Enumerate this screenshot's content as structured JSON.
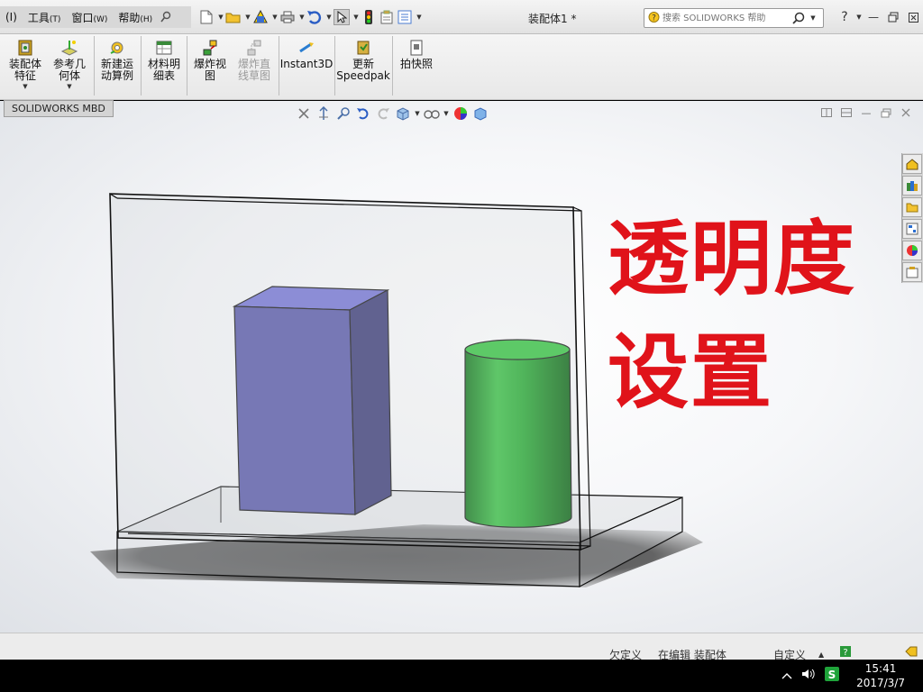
{
  "titlebar": {
    "menus": [
      {
        "label": "(I)",
        "accel": ""
      },
      {
        "label": "工具",
        "accel": "(T)"
      },
      {
        "label": "窗口",
        "accel": "(W)"
      },
      {
        "label": "帮助",
        "accel": "(H)"
      }
    ],
    "doc_title": "装配体1 *",
    "search_placeholder": "搜索 SOLIDWORKS 帮助"
  },
  "ribbon": {
    "buttons": [
      {
        "name": "assembly-features",
        "label": "装配体\n特征",
        "icon": "assembly-features-icon",
        "disabled": false
      },
      {
        "name": "reference-geometry",
        "label": "参考几\n何体",
        "icon": "reference-geometry-icon",
        "disabled": false
      },
      {
        "name": "new-motion-study",
        "label": "新建运\n动算例",
        "icon": "motion-study-icon",
        "disabled": false
      },
      {
        "name": "bill-of-materials",
        "label": "材料明\n细表",
        "icon": "bom-icon",
        "disabled": false
      },
      {
        "name": "exploded-view",
        "label": "爆炸视\n图",
        "icon": "exploded-view-icon",
        "disabled": false
      },
      {
        "name": "explode-line-sketch",
        "label": "爆炸直\n线草图",
        "icon": "explode-line-icon",
        "disabled": true
      },
      {
        "name": "instant3d",
        "label": "Instant3D",
        "icon": "instant3d-icon",
        "disabled": false
      },
      {
        "name": "update-speedpak",
        "label": "更新\nSpeedpak",
        "icon": "speedpak-icon",
        "disabled": false
      },
      {
        "name": "take-snapshot",
        "label": "拍快照",
        "icon": "snapshot-icon",
        "disabled": false
      }
    ]
  },
  "tabs": {
    "mbd": "SOLIDWORKS MBD"
  },
  "annotation": {
    "line1": "透明度",
    "line2": "设置"
  },
  "statusbar": {
    "under_defined": "欠定义",
    "editing": "在编辑 装配体",
    "custom": "自定义"
  },
  "taskbar": {
    "time": "15:41",
    "date": "2017/3/7"
  },
  "colors": {
    "annotation": "#e0131a",
    "box_front": "#6262b0",
    "box_top": "#7a7ad6",
    "box_side": "#45457f",
    "cylinder": "#2fae3a",
    "cylinder_top": "#3fc84a"
  }
}
